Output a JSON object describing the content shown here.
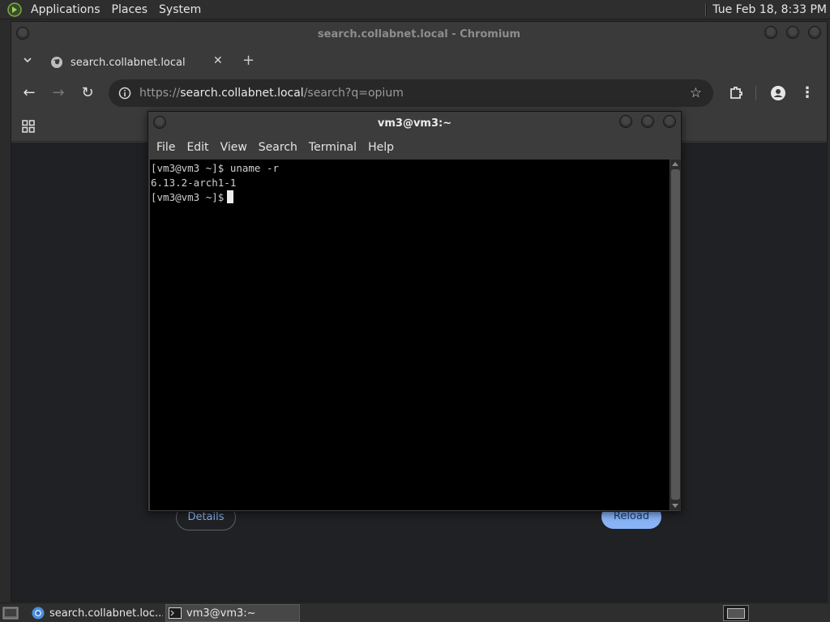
{
  "top_panel": {
    "menus": [
      "Applications",
      "Places",
      "System"
    ],
    "clock": "Tue Feb 18,  8:33 PM"
  },
  "chromium": {
    "window_title": "search.collabnet.local - Chromium",
    "tab": {
      "title": "search.collabnet.local",
      "close": "✕"
    },
    "new_tab": "+",
    "toolbar": {
      "back": "←",
      "forward": "→",
      "reload": "↻",
      "star": "☆",
      "menu": "⋮"
    },
    "url": {
      "scheme": "https://",
      "host": "search.collabnet.local",
      "path": "/search?q=opium"
    },
    "page": {
      "details_label": "Details",
      "reload_label": "Reload"
    }
  },
  "terminal": {
    "window_title": "vm3@vm3:~",
    "menus": [
      "File",
      "Edit",
      "View",
      "Search",
      "Terminal",
      "Help"
    ],
    "lines": [
      "[vm3@vm3 ~]$ uname -r",
      "6.13.2-arch1-1",
      "[vm3@vm3 ~]$"
    ]
  },
  "taskbar": {
    "tasks": [
      {
        "label": "search.collabnet.loc..."
      },
      {
        "label": "vm3@vm3:~"
      }
    ]
  },
  "colors": {
    "panel_bg": "#2e2e2e",
    "window_bg": "#3a3a3a",
    "page_bg": "#202124",
    "accent_blue": "#8ab4f8",
    "terminal_bg": "#000000"
  }
}
